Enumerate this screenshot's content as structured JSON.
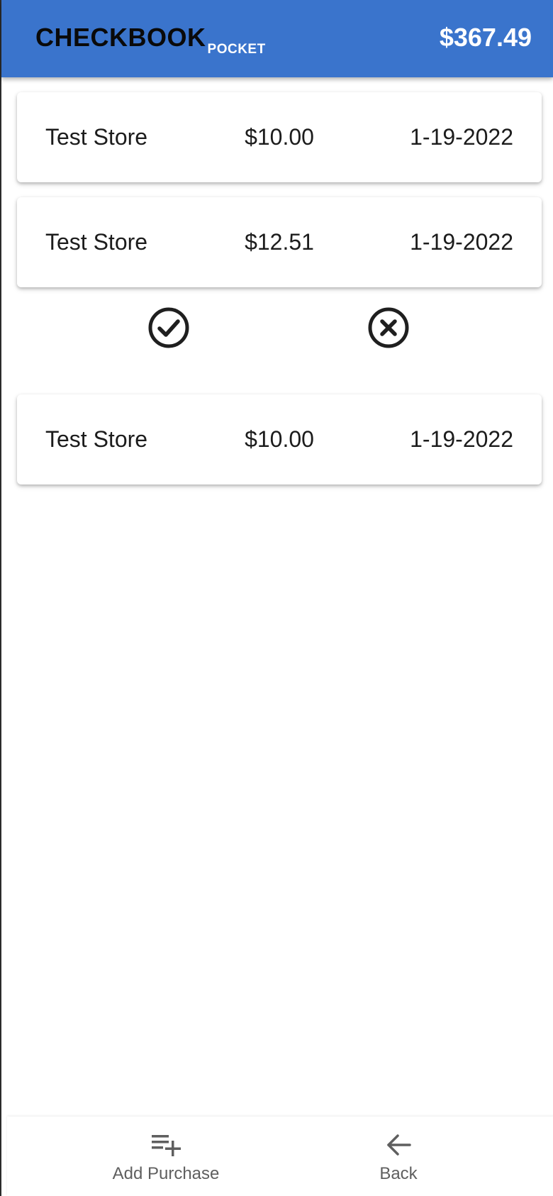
{
  "header": {
    "brand": "CHECKBOOK",
    "brand_sub": "POCKET",
    "balance": "$367.49",
    "color": "#3a74cc"
  },
  "transactions": [
    {
      "store": "Test Store",
      "amount": "$10.00",
      "date": "1-19-2022"
    },
    {
      "store": "Test Store",
      "amount": "$12.51",
      "date": "1-19-2022"
    },
    {
      "store": "Test Store",
      "amount": "$10.00",
      "date": "1-19-2022"
    }
  ],
  "actions": {
    "confirm_icon": "check-circle-icon",
    "cancel_icon": "close-circle-icon"
  },
  "bottom_nav": {
    "add_label": "Add Purchase",
    "add_icon": "playlist-add-icon",
    "back_label": "Back",
    "back_icon": "arrow-left-icon"
  }
}
